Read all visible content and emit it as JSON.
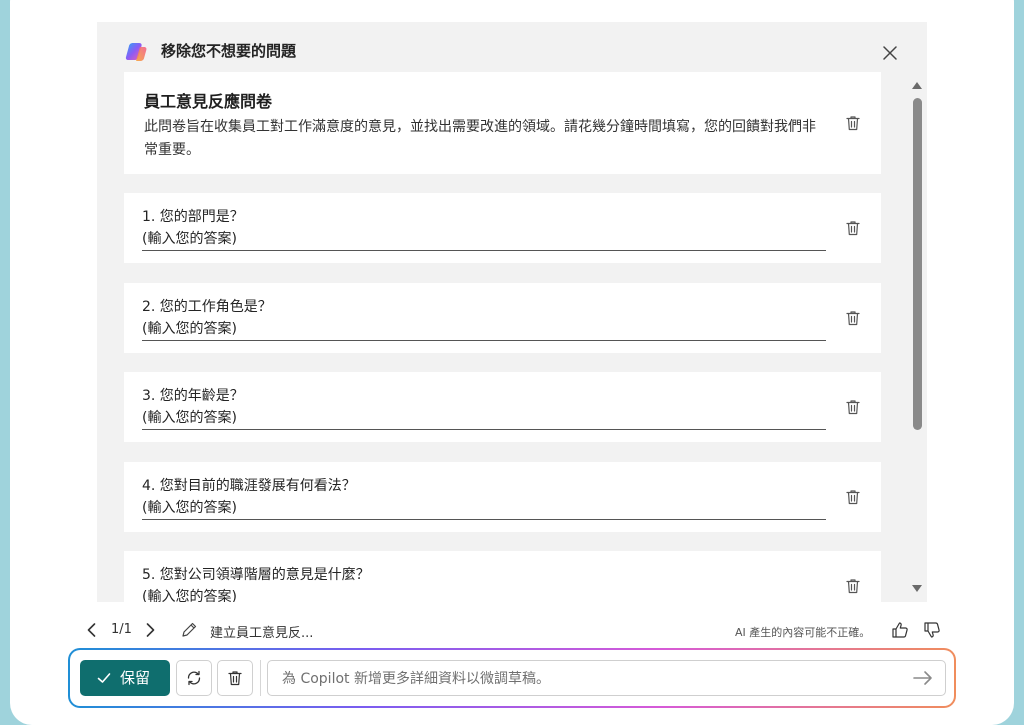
{
  "panel": {
    "title": "移除您不想要的問題",
    "survey_title": "員工意見反應問卷",
    "survey_description": "此問卷旨在收集員工對工作滿意度的意見，並找出需要改進的領域。請花幾分鐘時間填寫，您的回饋對我們非常重要。",
    "questions": [
      {
        "label": "1. 您的部門是？",
        "answer": "(輸入您的答案)"
      },
      {
        "label": "2. 您的工作角色是？",
        "answer": "(輸入您的答案)"
      },
      {
        "label": "3. 您的年齡是？",
        "answer": "(輸入您的答案)"
      },
      {
        "label": "4. 您對目前的職涯發展有何看法？",
        "answer": "(輸入您的答案)"
      },
      {
        "label": "5. 您對公司領導階層的意見是什麼？",
        "answer": "(輸入您的答案)"
      }
    ]
  },
  "footer": {
    "page_indicator": "1/1",
    "draft_name": "建立員工意見反...",
    "ai_note": "AI 產生的內容可能不正確。"
  },
  "actions": {
    "keep_label": "保留",
    "prompt_placeholder": "為 Copilot 新增更多詳細資料以微調草稿。"
  },
  "icons": {
    "logo": "copilot-logo",
    "close": "close-icon",
    "delete": "trash-icon",
    "prev": "chevron-left-icon",
    "next": "chevron-right-icon",
    "edit": "pencil-icon",
    "like": "thumbs-up-icon",
    "dislike": "thumbs-down-icon",
    "regenerate": "refresh-icon",
    "send": "send-arrow-icon",
    "keep": "checkmark-icon"
  },
  "colors": {
    "keep_button": "#0f6e6e",
    "page_background": "#9fd3dc",
    "panel_background": "#f2f2f2"
  }
}
